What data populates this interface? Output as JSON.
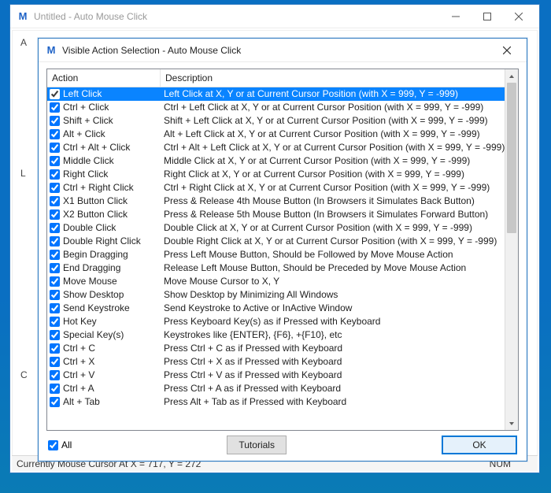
{
  "main_window": {
    "app_icon_letter": "M",
    "title": "Untitled - Auto Mouse Click",
    "stub_labels": {
      "a": "A",
      "l": "L",
      "c": "C"
    }
  },
  "dialog": {
    "app_icon_letter": "M",
    "title": "Visible Action Selection - Auto Mouse Click",
    "columns": {
      "action": "Action",
      "description": "Description"
    },
    "rows": [
      {
        "checked": true,
        "selected": true,
        "action": "Left Click",
        "desc": "Left Click at X, Y or at Current Cursor Position (with X = 999, Y = -999)"
      },
      {
        "checked": true,
        "selected": false,
        "action": "Ctrl + Click",
        "desc": "Ctrl + Left Click at X, Y or at Current Cursor Position (with X = 999, Y = -999)"
      },
      {
        "checked": true,
        "selected": false,
        "action": "Shift + Click",
        "desc": "Shift + Left Click at X, Y or at Current Cursor Position (with X = 999, Y = -999)"
      },
      {
        "checked": true,
        "selected": false,
        "action": "Alt + Click",
        "desc": "Alt + Left Click at X, Y or at Current Cursor Position (with X = 999, Y = -999)"
      },
      {
        "checked": true,
        "selected": false,
        "action": "Ctrl + Alt + Click",
        "desc": "Ctrl + Alt + Left Click at X, Y or at Current Cursor Position (with X = 999, Y = -999)"
      },
      {
        "checked": true,
        "selected": false,
        "action": "Middle Click",
        "desc": "Middle Click at X, Y or at Current Cursor Position (with X = 999, Y = -999)"
      },
      {
        "checked": true,
        "selected": false,
        "action": "Right Click",
        "desc": "Right Click at X, Y or at Current Cursor Position (with X = 999, Y = -999)"
      },
      {
        "checked": true,
        "selected": false,
        "action": "Ctrl + Right Click",
        "desc": "Ctrl + Right Click at X, Y or at Current Cursor Position (with X = 999, Y = -999)"
      },
      {
        "checked": true,
        "selected": false,
        "action": "X1 Button Click",
        "desc": "Press & Release 4th Mouse Button (In Browsers it Simulates Back Button)"
      },
      {
        "checked": true,
        "selected": false,
        "action": "X2 Button Click",
        "desc": "Press & Release 5th Mouse Button (In Browsers it Simulates Forward Button)"
      },
      {
        "checked": true,
        "selected": false,
        "action": "Double Click",
        "desc": "Double Click at X, Y or at Current Cursor Position (with X = 999, Y = -999)"
      },
      {
        "checked": true,
        "selected": false,
        "action": "Double Right Click",
        "desc": "Double Right Click at X, Y or at Current Cursor Position (with X = 999, Y = -999)"
      },
      {
        "checked": true,
        "selected": false,
        "action": "Begin Dragging",
        "desc": "Press Left Mouse Button, Should be Followed by Move Mouse Action"
      },
      {
        "checked": true,
        "selected": false,
        "action": "End Dragging",
        "desc": "Release Left Mouse Button, Should be Preceded by Move Mouse Action"
      },
      {
        "checked": true,
        "selected": false,
        "action": "Move Mouse",
        "desc": "Move Mouse Cursor to X, Y"
      },
      {
        "checked": true,
        "selected": false,
        "action": "Show Desktop",
        "desc": "Show Desktop by Minimizing All Windows"
      },
      {
        "checked": true,
        "selected": false,
        "action": "Send Keystroke",
        "desc": "Send Keystroke to Active or InActive Window"
      },
      {
        "checked": true,
        "selected": false,
        "action": "Hot Key",
        "desc": "Press Keyboard Key(s) as if Pressed with Keyboard"
      },
      {
        "checked": true,
        "selected": false,
        "action": "Special Key(s)",
        "desc": "Keystrokes like {ENTER}, {F6}, +{F10}, etc"
      },
      {
        "checked": true,
        "selected": false,
        "action": "Ctrl + C",
        "desc": "Press Ctrl + C as if Pressed with Keyboard"
      },
      {
        "checked": true,
        "selected": false,
        "action": "Ctrl + X",
        "desc": "Press Ctrl + X as if Pressed with Keyboard"
      },
      {
        "checked": true,
        "selected": false,
        "action": "Ctrl + V",
        "desc": "Press Ctrl + V as if Pressed with Keyboard"
      },
      {
        "checked": true,
        "selected": false,
        "action": "Ctrl + A",
        "desc": "Press Ctrl + A as if Pressed with Keyboard"
      },
      {
        "checked": true,
        "selected": false,
        "action": "Alt + Tab",
        "desc": "Press Alt + Tab as if Pressed with Keyboard"
      }
    ],
    "all_checkbox": {
      "checked": true,
      "label": "All"
    },
    "buttons": {
      "tutorials": "Tutorials",
      "ok": "OK"
    }
  },
  "statusbar": {
    "cursor_text": "Currently Mouse Cursor At X = 717, Y = 272",
    "num": "NUM"
  }
}
